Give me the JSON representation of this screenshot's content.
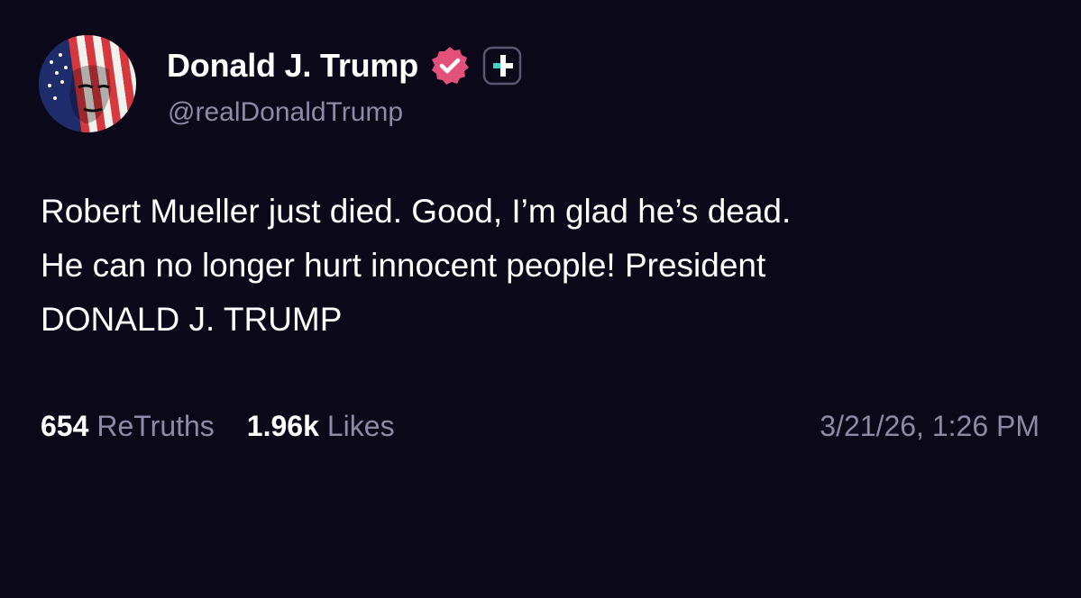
{
  "author": {
    "display_name": "Donald J. Trump",
    "handle": "@realDonaldTrump",
    "avatar_icon": "avatar-flag-portrait-icon",
    "verified_icon": "verified-badge-icon",
    "verified_color": "#e3507a",
    "extra_badge_icon": "plus-badge-icon",
    "extra_badge_accent": "#3fd3c0"
  },
  "post": {
    "text": "Robert Mueller just died. Good, I’m glad he’s dead.\nHe can no longer hurt innocent people! President\nDONALD J. TRUMP"
  },
  "stats": {
    "retruths_count": "654",
    "retruths_label": "ReTruths",
    "likes_count": "1.96k",
    "likes_label": "Likes"
  },
  "timestamp": "3/21/26, 1:26 PM",
  "colors": {
    "background": "#0b0819",
    "text_primary": "#ffffff",
    "text_secondary": "#8e8aa6"
  }
}
